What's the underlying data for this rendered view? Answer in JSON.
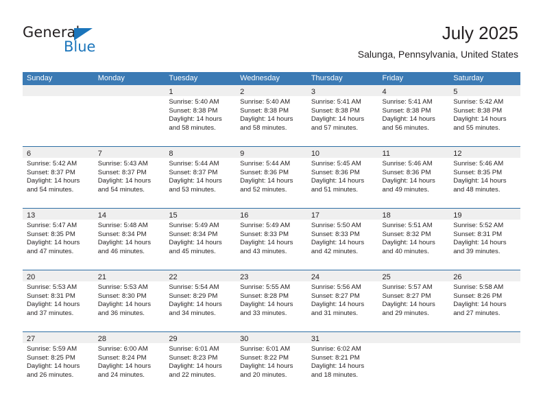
{
  "logo": {
    "primary_text": "General",
    "secondary_text": "Blue",
    "triangle_color": "#1b75bb",
    "primary_color": "#231f20",
    "secondary_color": "#1b75bb"
  },
  "header": {
    "title": "July 2025",
    "subtitle": "Salunga, Pennsylvania, United States"
  },
  "colors": {
    "header_row": "#3b7ab4",
    "row_divider": "#2b6ca3",
    "date_band": "#efefef",
    "text": "#231f20"
  },
  "calendar": {
    "day_headers": [
      "Sunday",
      "Monday",
      "Tuesday",
      "Wednesday",
      "Thursday",
      "Friday",
      "Saturday"
    ],
    "weeks": [
      [
        {
          "date": "",
          "sunrise": "",
          "sunset": "",
          "daylight_line1": "",
          "daylight_line2": "",
          "empty": true
        },
        {
          "date": "",
          "sunrise": "",
          "sunset": "",
          "daylight_line1": "",
          "daylight_line2": "",
          "empty": true
        },
        {
          "date": "1",
          "sunrise": "Sunrise: 5:40 AM",
          "sunset": "Sunset: 8:38 PM",
          "daylight_line1": "Daylight: 14 hours",
          "daylight_line2": "and 58 minutes.",
          "empty": false
        },
        {
          "date": "2",
          "sunrise": "Sunrise: 5:40 AM",
          "sunset": "Sunset: 8:38 PM",
          "daylight_line1": "Daylight: 14 hours",
          "daylight_line2": "and 58 minutes.",
          "empty": false
        },
        {
          "date": "3",
          "sunrise": "Sunrise: 5:41 AM",
          "sunset": "Sunset: 8:38 PM",
          "daylight_line1": "Daylight: 14 hours",
          "daylight_line2": "and 57 minutes.",
          "empty": false
        },
        {
          "date": "4",
          "sunrise": "Sunrise: 5:41 AM",
          "sunset": "Sunset: 8:38 PM",
          "daylight_line1": "Daylight: 14 hours",
          "daylight_line2": "and 56 minutes.",
          "empty": false
        },
        {
          "date": "5",
          "sunrise": "Sunrise: 5:42 AM",
          "sunset": "Sunset: 8:38 PM",
          "daylight_line1": "Daylight: 14 hours",
          "daylight_line2": "and 55 minutes.",
          "empty": false
        }
      ],
      [
        {
          "date": "6",
          "sunrise": "Sunrise: 5:42 AM",
          "sunset": "Sunset: 8:37 PM",
          "daylight_line1": "Daylight: 14 hours",
          "daylight_line2": "and 54 minutes.",
          "empty": false
        },
        {
          "date": "7",
          "sunrise": "Sunrise: 5:43 AM",
          "sunset": "Sunset: 8:37 PM",
          "daylight_line1": "Daylight: 14 hours",
          "daylight_line2": "and 54 minutes.",
          "empty": false
        },
        {
          "date": "8",
          "sunrise": "Sunrise: 5:44 AM",
          "sunset": "Sunset: 8:37 PM",
          "daylight_line1": "Daylight: 14 hours",
          "daylight_line2": "and 53 minutes.",
          "empty": false
        },
        {
          "date": "9",
          "sunrise": "Sunrise: 5:44 AM",
          "sunset": "Sunset: 8:36 PM",
          "daylight_line1": "Daylight: 14 hours",
          "daylight_line2": "and 52 minutes.",
          "empty": false
        },
        {
          "date": "10",
          "sunrise": "Sunrise: 5:45 AM",
          "sunset": "Sunset: 8:36 PM",
          "daylight_line1": "Daylight: 14 hours",
          "daylight_line2": "and 51 minutes.",
          "empty": false
        },
        {
          "date": "11",
          "sunrise": "Sunrise: 5:46 AM",
          "sunset": "Sunset: 8:36 PM",
          "daylight_line1": "Daylight: 14 hours",
          "daylight_line2": "and 49 minutes.",
          "empty": false
        },
        {
          "date": "12",
          "sunrise": "Sunrise: 5:46 AM",
          "sunset": "Sunset: 8:35 PM",
          "daylight_line1": "Daylight: 14 hours",
          "daylight_line2": "and 48 minutes.",
          "empty": false
        }
      ],
      [
        {
          "date": "13",
          "sunrise": "Sunrise: 5:47 AM",
          "sunset": "Sunset: 8:35 PM",
          "daylight_line1": "Daylight: 14 hours",
          "daylight_line2": "and 47 minutes.",
          "empty": false
        },
        {
          "date": "14",
          "sunrise": "Sunrise: 5:48 AM",
          "sunset": "Sunset: 8:34 PM",
          "daylight_line1": "Daylight: 14 hours",
          "daylight_line2": "and 46 minutes.",
          "empty": false
        },
        {
          "date": "15",
          "sunrise": "Sunrise: 5:49 AM",
          "sunset": "Sunset: 8:34 PM",
          "daylight_line1": "Daylight: 14 hours",
          "daylight_line2": "and 45 minutes.",
          "empty": false
        },
        {
          "date": "16",
          "sunrise": "Sunrise: 5:49 AM",
          "sunset": "Sunset: 8:33 PM",
          "daylight_line1": "Daylight: 14 hours",
          "daylight_line2": "and 43 minutes.",
          "empty": false
        },
        {
          "date": "17",
          "sunrise": "Sunrise: 5:50 AM",
          "sunset": "Sunset: 8:33 PM",
          "daylight_line1": "Daylight: 14 hours",
          "daylight_line2": "and 42 minutes.",
          "empty": false
        },
        {
          "date": "18",
          "sunrise": "Sunrise: 5:51 AM",
          "sunset": "Sunset: 8:32 PM",
          "daylight_line1": "Daylight: 14 hours",
          "daylight_line2": "and 40 minutes.",
          "empty": false
        },
        {
          "date": "19",
          "sunrise": "Sunrise: 5:52 AM",
          "sunset": "Sunset: 8:31 PM",
          "daylight_line1": "Daylight: 14 hours",
          "daylight_line2": "and 39 minutes.",
          "empty": false
        }
      ],
      [
        {
          "date": "20",
          "sunrise": "Sunrise: 5:53 AM",
          "sunset": "Sunset: 8:31 PM",
          "daylight_line1": "Daylight: 14 hours",
          "daylight_line2": "and 37 minutes.",
          "empty": false
        },
        {
          "date": "21",
          "sunrise": "Sunrise: 5:53 AM",
          "sunset": "Sunset: 8:30 PM",
          "daylight_line1": "Daylight: 14 hours",
          "daylight_line2": "and 36 minutes.",
          "empty": false
        },
        {
          "date": "22",
          "sunrise": "Sunrise: 5:54 AM",
          "sunset": "Sunset: 8:29 PM",
          "daylight_line1": "Daylight: 14 hours",
          "daylight_line2": "and 34 minutes.",
          "empty": false
        },
        {
          "date": "23",
          "sunrise": "Sunrise: 5:55 AM",
          "sunset": "Sunset: 8:28 PM",
          "daylight_line1": "Daylight: 14 hours",
          "daylight_line2": "and 33 minutes.",
          "empty": false
        },
        {
          "date": "24",
          "sunrise": "Sunrise: 5:56 AM",
          "sunset": "Sunset: 8:27 PM",
          "daylight_line1": "Daylight: 14 hours",
          "daylight_line2": "and 31 minutes.",
          "empty": false
        },
        {
          "date": "25",
          "sunrise": "Sunrise: 5:57 AM",
          "sunset": "Sunset: 8:27 PM",
          "daylight_line1": "Daylight: 14 hours",
          "daylight_line2": "and 29 minutes.",
          "empty": false
        },
        {
          "date": "26",
          "sunrise": "Sunrise: 5:58 AM",
          "sunset": "Sunset: 8:26 PM",
          "daylight_line1": "Daylight: 14 hours",
          "daylight_line2": "and 27 minutes.",
          "empty": false
        }
      ],
      [
        {
          "date": "27",
          "sunrise": "Sunrise: 5:59 AM",
          "sunset": "Sunset: 8:25 PM",
          "daylight_line1": "Daylight: 14 hours",
          "daylight_line2": "and 26 minutes.",
          "empty": false
        },
        {
          "date": "28",
          "sunrise": "Sunrise: 6:00 AM",
          "sunset": "Sunset: 8:24 PM",
          "daylight_line1": "Daylight: 14 hours",
          "daylight_line2": "and 24 minutes.",
          "empty": false
        },
        {
          "date": "29",
          "sunrise": "Sunrise: 6:01 AM",
          "sunset": "Sunset: 8:23 PM",
          "daylight_line1": "Daylight: 14 hours",
          "daylight_line2": "and 22 minutes.",
          "empty": false
        },
        {
          "date": "30",
          "sunrise": "Sunrise: 6:01 AM",
          "sunset": "Sunset: 8:22 PM",
          "daylight_line1": "Daylight: 14 hours",
          "daylight_line2": "and 20 minutes.",
          "empty": false
        },
        {
          "date": "31",
          "sunrise": "Sunrise: 6:02 AM",
          "sunset": "Sunset: 8:21 PM",
          "daylight_line1": "Daylight: 14 hours",
          "daylight_line2": "and 18 minutes.",
          "empty": false
        },
        {
          "date": "",
          "sunrise": "",
          "sunset": "",
          "daylight_line1": "",
          "daylight_line2": "",
          "empty": true
        },
        {
          "date": "",
          "sunrise": "",
          "sunset": "",
          "daylight_line1": "",
          "daylight_line2": "",
          "empty": true
        }
      ]
    ]
  }
}
